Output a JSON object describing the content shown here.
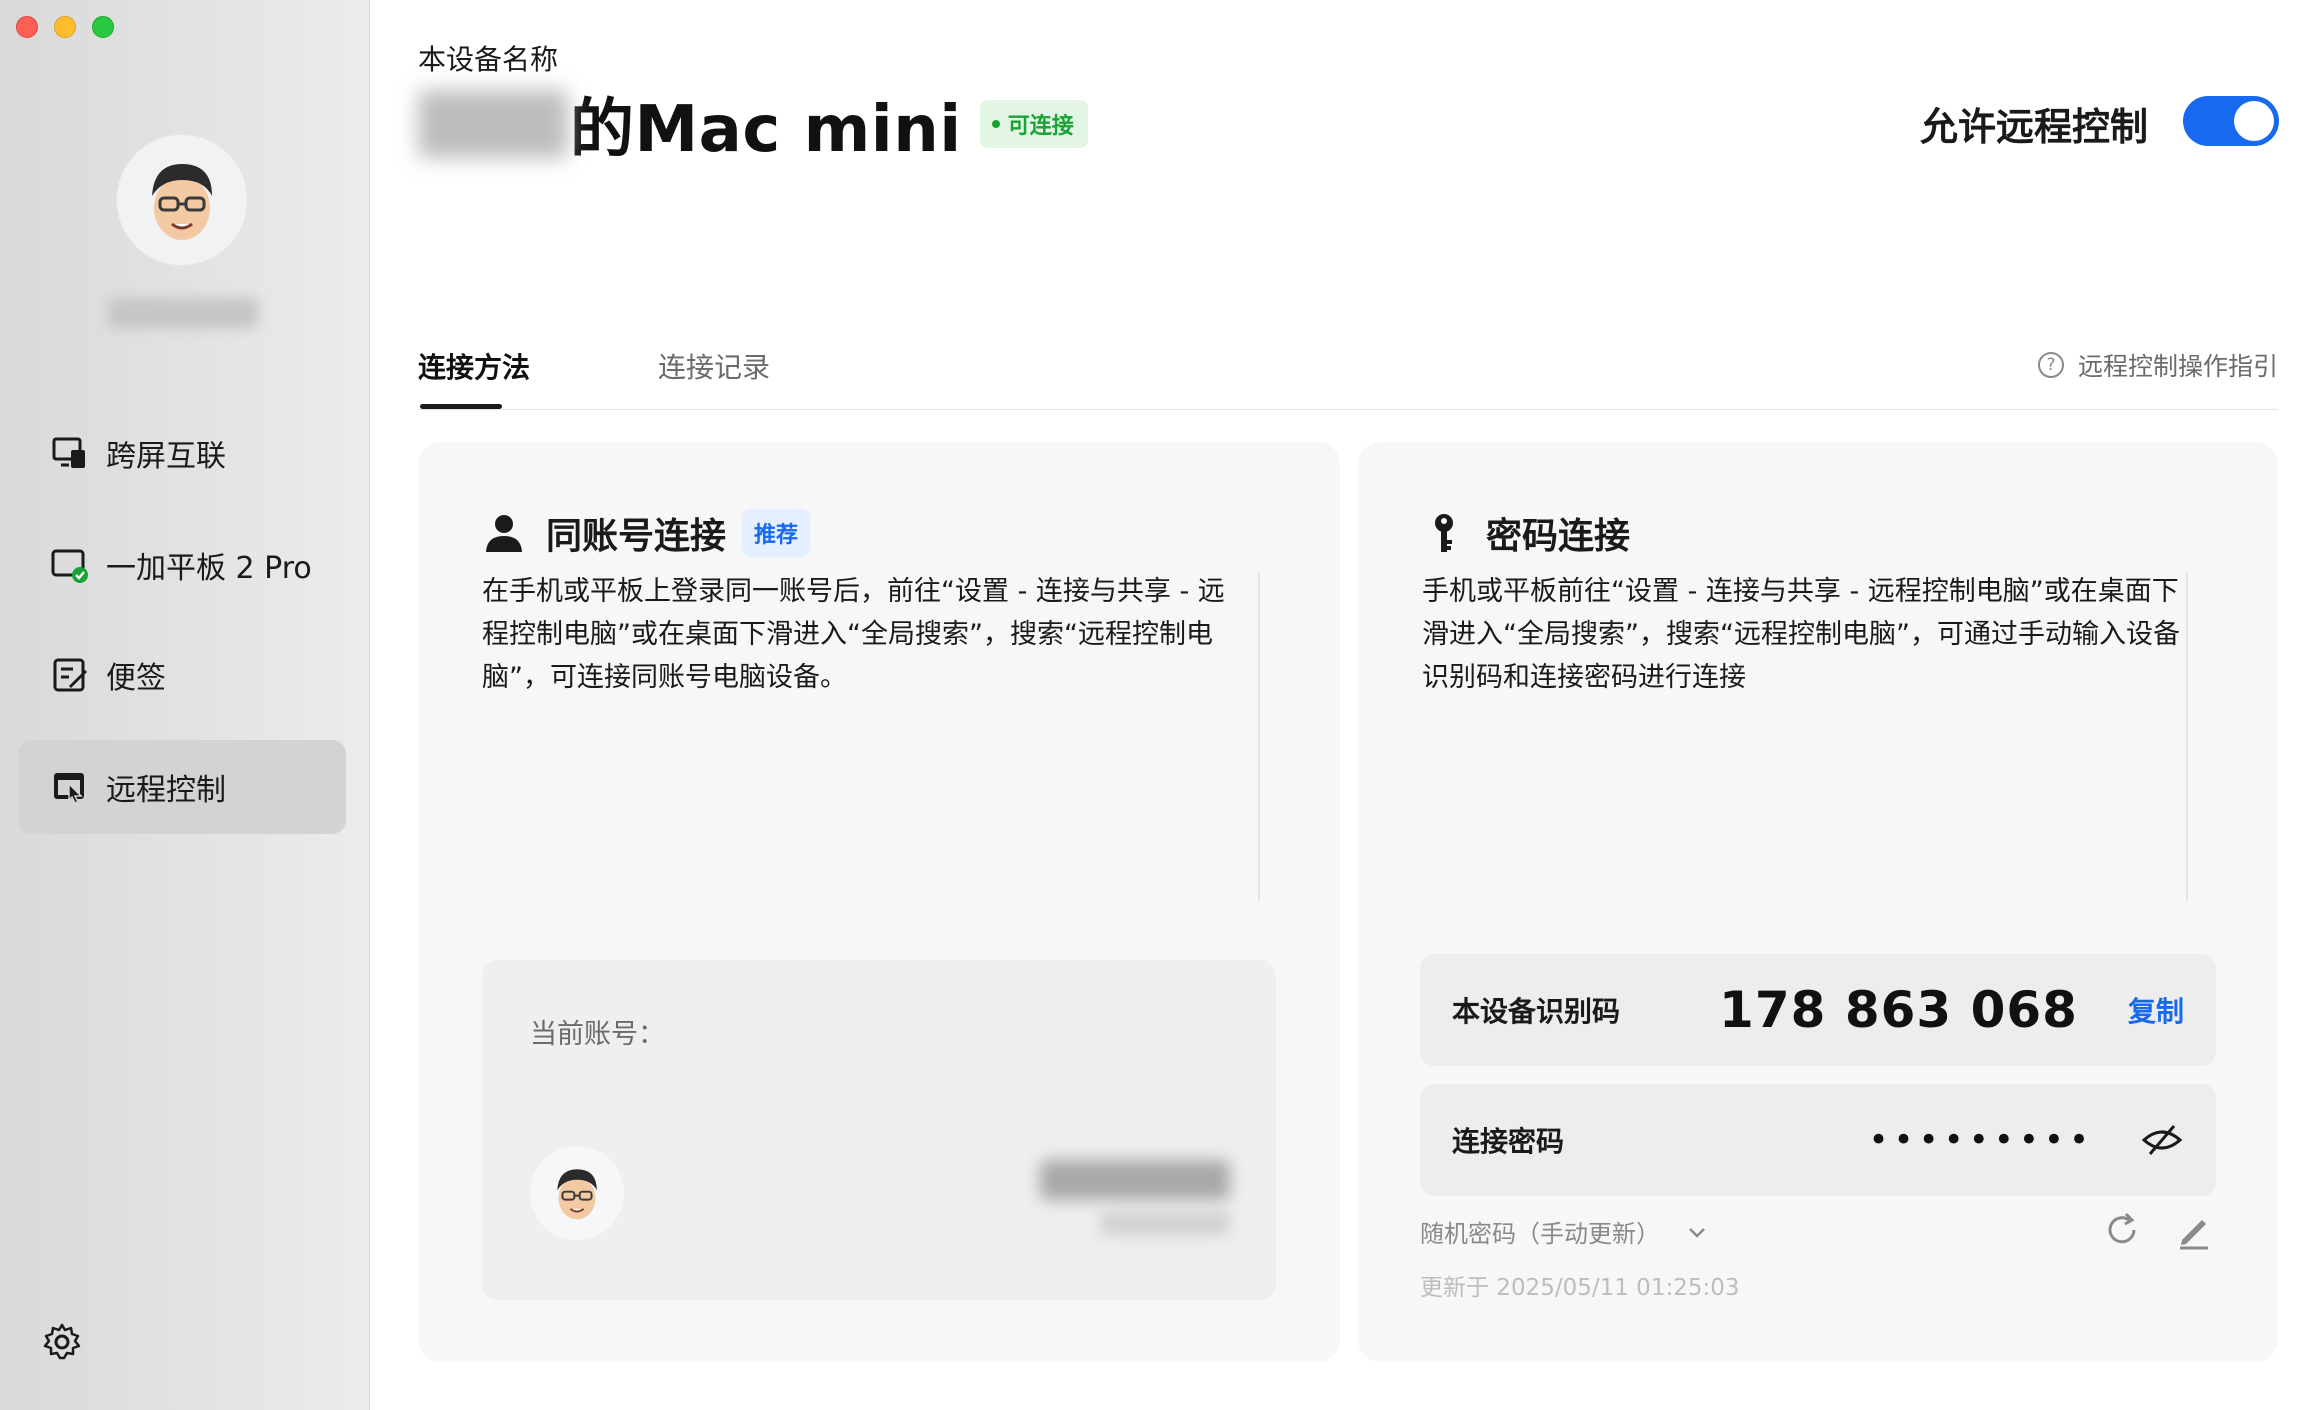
{
  "sidebar": {
    "nav": [
      {
        "label": "跨屏互联",
        "icon": "screen-link-icon"
      },
      {
        "label": "一加平板 2 Pro",
        "icon": "tablet-connected-icon"
      },
      {
        "label": "便签",
        "icon": "note-edit-icon"
      },
      {
        "label": "远程控制",
        "icon": "remote-control-icon",
        "active": true
      }
    ],
    "settings_icon": "gear-icon"
  },
  "header": {
    "caption": "本设备名称",
    "device_name": "的Mac mini",
    "status": "可连接",
    "allow_label": "允许远程控制",
    "allow_enabled": true
  },
  "tabs": [
    {
      "label": "连接方法",
      "active": true
    },
    {
      "label": "连接记录",
      "active": false
    }
  ],
  "guide_link": "远程控制操作指引",
  "same_account": {
    "title": "同账号连接",
    "badge": "推荐",
    "description": "在手机或平板上登录同一账号后，前往“设置 - 连接与共享 - 远程控制电脑”或在桌面下滑进入“全局搜索”，搜索“远程控制电脑”，可连接同账号电脑设备。",
    "current_account_label": "当前账号："
  },
  "password_connect": {
    "title": "密码连接",
    "description": "手机或平板前往“设置 - 连接与共享 - 远程控制电脑”或在桌面下滑进入“全局搜索”，搜索“远程控制电脑”，可通过手动输入设备识别码和连接密码进行连接",
    "device_id_label": "本设备识别码",
    "device_id": "178 863 068",
    "copy_label": "复制",
    "password_label": "连接密码",
    "password_mask": "•••••••••",
    "password_mode": "随机密码（手动更新）",
    "updated_at": "更新于 2025/05/11 01:25:03"
  },
  "colors": {
    "accent": "#1769f0",
    "online_green": "#1aa333"
  }
}
